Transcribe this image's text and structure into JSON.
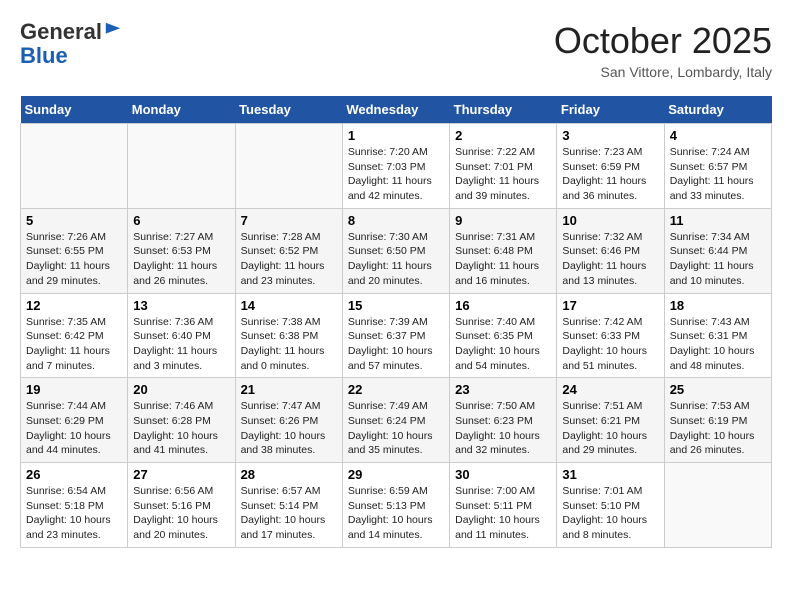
{
  "logo": {
    "general": "General",
    "blue": "Blue"
  },
  "title": "October 2025",
  "location": "San Vittore, Lombardy, Italy",
  "days_of_week": [
    "Sunday",
    "Monday",
    "Tuesday",
    "Wednesday",
    "Thursday",
    "Friday",
    "Saturday"
  ],
  "weeks": [
    [
      {
        "day": "",
        "info": ""
      },
      {
        "day": "",
        "info": ""
      },
      {
        "day": "",
        "info": ""
      },
      {
        "day": "1",
        "info": "Sunrise: 7:20 AM\nSunset: 7:03 PM\nDaylight: 11 hours and 42 minutes."
      },
      {
        "day": "2",
        "info": "Sunrise: 7:22 AM\nSunset: 7:01 PM\nDaylight: 11 hours and 39 minutes."
      },
      {
        "day": "3",
        "info": "Sunrise: 7:23 AM\nSunset: 6:59 PM\nDaylight: 11 hours and 36 minutes."
      },
      {
        "day": "4",
        "info": "Sunrise: 7:24 AM\nSunset: 6:57 PM\nDaylight: 11 hours and 33 minutes."
      }
    ],
    [
      {
        "day": "5",
        "info": "Sunrise: 7:26 AM\nSunset: 6:55 PM\nDaylight: 11 hours and 29 minutes."
      },
      {
        "day": "6",
        "info": "Sunrise: 7:27 AM\nSunset: 6:53 PM\nDaylight: 11 hours and 26 minutes."
      },
      {
        "day": "7",
        "info": "Sunrise: 7:28 AM\nSunset: 6:52 PM\nDaylight: 11 hours and 23 minutes."
      },
      {
        "day": "8",
        "info": "Sunrise: 7:30 AM\nSunset: 6:50 PM\nDaylight: 11 hours and 20 minutes."
      },
      {
        "day": "9",
        "info": "Sunrise: 7:31 AM\nSunset: 6:48 PM\nDaylight: 11 hours and 16 minutes."
      },
      {
        "day": "10",
        "info": "Sunrise: 7:32 AM\nSunset: 6:46 PM\nDaylight: 11 hours and 13 minutes."
      },
      {
        "day": "11",
        "info": "Sunrise: 7:34 AM\nSunset: 6:44 PM\nDaylight: 11 hours and 10 minutes."
      }
    ],
    [
      {
        "day": "12",
        "info": "Sunrise: 7:35 AM\nSunset: 6:42 PM\nDaylight: 11 hours and 7 minutes."
      },
      {
        "day": "13",
        "info": "Sunrise: 7:36 AM\nSunset: 6:40 PM\nDaylight: 11 hours and 3 minutes."
      },
      {
        "day": "14",
        "info": "Sunrise: 7:38 AM\nSunset: 6:38 PM\nDaylight: 11 hours and 0 minutes."
      },
      {
        "day": "15",
        "info": "Sunrise: 7:39 AM\nSunset: 6:37 PM\nDaylight: 10 hours and 57 minutes."
      },
      {
        "day": "16",
        "info": "Sunrise: 7:40 AM\nSunset: 6:35 PM\nDaylight: 10 hours and 54 minutes."
      },
      {
        "day": "17",
        "info": "Sunrise: 7:42 AM\nSunset: 6:33 PM\nDaylight: 10 hours and 51 minutes."
      },
      {
        "day": "18",
        "info": "Sunrise: 7:43 AM\nSunset: 6:31 PM\nDaylight: 10 hours and 48 minutes."
      }
    ],
    [
      {
        "day": "19",
        "info": "Sunrise: 7:44 AM\nSunset: 6:29 PM\nDaylight: 10 hours and 44 minutes."
      },
      {
        "day": "20",
        "info": "Sunrise: 7:46 AM\nSunset: 6:28 PM\nDaylight: 10 hours and 41 minutes."
      },
      {
        "day": "21",
        "info": "Sunrise: 7:47 AM\nSunset: 6:26 PM\nDaylight: 10 hours and 38 minutes."
      },
      {
        "day": "22",
        "info": "Sunrise: 7:49 AM\nSunset: 6:24 PM\nDaylight: 10 hours and 35 minutes."
      },
      {
        "day": "23",
        "info": "Sunrise: 7:50 AM\nSunset: 6:23 PM\nDaylight: 10 hours and 32 minutes."
      },
      {
        "day": "24",
        "info": "Sunrise: 7:51 AM\nSunset: 6:21 PM\nDaylight: 10 hours and 29 minutes."
      },
      {
        "day": "25",
        "info": "Sunrise: 7:53 AM\nSunset: 6:19 PM\nDaylight: 10 hours and 26 minutes."
      }
    ],
    [
      {
        "day": "26",
        "info": "Sunrise: 6:54 AM\nSunset: 5:18 PM\nDaylight: 10 hours and 23 minutes."
      },
      {
        "day": "27",
        "info": "Sunrise: 6:56 AM\nSunset: 5:16 PM\nDaylight: 10 hours and 20 minutes."
      },
      {
        "day": "28",
        "info": "Sunrise: 6:57 AM\nSunset: 5:14 PM\nDaylight: 10 hours and 17 minutes."
      },
      {
        "day": "29",
        "info": "Sunrise: 6:59 AM\nSunset: 5:13 PM\nDaylight: 10 hours and 14 minutes."
      },
      {
        "day": "30",
        "info": "Sunrise: 7:00 AM\nSunset: 5:11 PM\nDaylight: 10 hours and 11 minutes."
      },
      {
        "day": "31",
        "info": "Sunrise: 7:01 AM\nSunset: 5:10 PM\nDaylight: 10 hours and 8 minutes."
      },
      {
        "day": "",
        "info": ""
      }
    ]
  ]
}
